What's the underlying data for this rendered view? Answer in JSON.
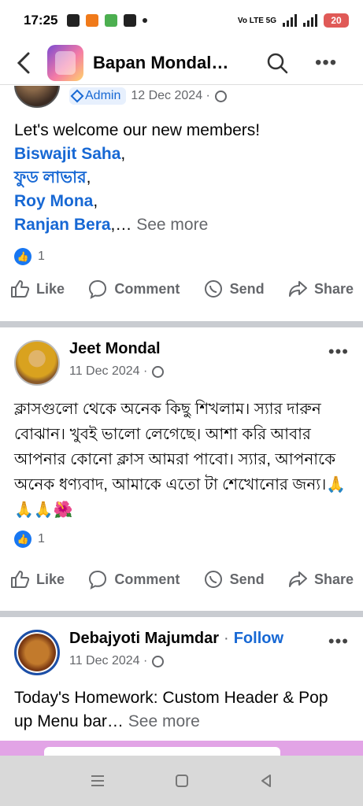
{
  "status_bar": {
    "time": "17:25",
    "battery": "20",
    "network_label": "Vo LTE 5G"
  },
  "header": {
    "group_name": "Bapan Mondal…",
    "back_icon": "back-arrow-icon",
    "search_icon": "search-icon",
    "more_icon": "more-dots-icon"
  },
  "posts": [
    {
      "role_badge": "Admin",
      "date": "12 Dec 2024 ·",
      "text": "Let's welcome our new members!",
      "mentions": [
        "Biswajit Saha",
        "ফুড লাভার",
        "Roy Mona",
        "Ranjan Bera"
      ],
      "mention_seps": [
        ",",
        ",",
        ",",
        ",…"
      ],
      "see_more": "See more",
      "reaction_count": "1"
    },
    {
      "author": "Jeet Mondal",
      "date": "11 Dec 2024 ·",
      "text": "ক্লাসগুলো থেকে অনেক কিছু শিখলাম। স্যার দারুন বোঝান। খুবই ভালো লেগেছে। আশা করি আবার আপনার কোনো ক্লাস আমরা পাবো। স্যার, আপনাকে অনেক ধণ্যবাদ, আমাকে এতো টা শেখোনোর জন্য।🙏🙏🙏🌺",
      "reaction_count": "1"
    },
    {
      "author": "Debajyoti Majumdar",
      "follow_sep": "·",
      "follow": "Follow",
      "date": "11 Dec 2024 ·",
      "text": "Today's Homework: Custom Header & Pop up Menu bar…",
      "see_more": "See more"
    }
  ],
  "actions": {
    "like": "Like",
    "comment": "Comment",
    "send": "Send",
    "share": "Share"
  },
  "colors": {
    "accent": "#1768d4",
    "divider": "#c9ccd1",
    "muted": "#65676b"
  }
}
